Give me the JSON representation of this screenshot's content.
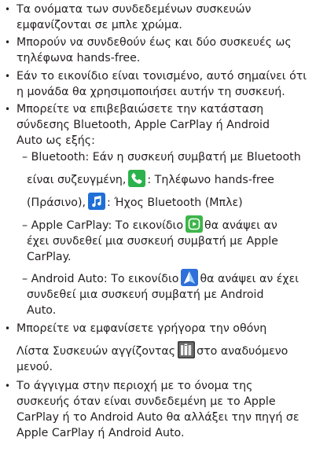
{
  "bullets": {
    "b1": [
      "Τα ονόματα των συνδεδεμένων συσκευών",
      "εμφανίζονται σε μπλε χρώμα."
    ],
    "b2": [
      "Μπορούν να συνδεθούν έως και δύο συσκευές ως",
      "τηλέφωνα hands-free."
    ],
    "b3": [
      "Εάν το εικονίδιο είναι τονισμένο, αυτό σημαίνει ότι",
      "η μονάδα θα χρησιμοποιήσει αυτήν τη συσκευή."
    ],
    "b4": [
      "Μπορείτε να επιβεβαιώσετε την κατάσταση",
      "σύνδεσης Bluetooth, Apple CarPlay ή Android",
      "Auto ως εξής:"
    ],
    "b5_l1": "Μπορείτε να εμφανίσετε γρήγορα την οθόνη",
    "b5_l2a": "Λίστα Συσκευών αγγίζοντας",
    "b5_l2b": "στο αναδυόμενο",
    "b5_l3": "μενού.",
    "b6": [
      "Το άγγιγμα στην περιοχή με το όνομα της",
      "συσκευής όταν είναι συνδεδεμένη με το Apple",
      "CarPlay ή το Android Auto θα αλλάξει την πηγή σε",
      "Apple CarPlay ή Android Auto."
    ]
  },
  "subs": {
    "bt_l1": "– Bluetooth: Εάν η συσκευή συμβατή με Bluetooth",
    "bt_l2a": "είναι συζευγμένη,",
    "bt_l2b": ": Τηλέφωνο hands-free",
    "bt_l3a": "(Πράσινο),",
    "bt_l3b": ": Ήχος Bluetooth (Μπλε)",
    "cp_l1a": "– Apple CarPlay: Το εικονίδιο",
    "cp_l1b": "θα ανάψει αν",
    "cp_l2": "έχει συνδεθεί μια συσκευή συμβατή με Apple",
    "cp_l3": "CarPlay.",
    "aa_l1a": "– Android Auto: Το εικονίδιο",
    "aa_l1b": "θα ανάψει αν έχει",
    "aa_l2": "συνδεθεί μια συσκευή συμβατή με Android",
    "aa_l3": "Auto."
  },
  "bullet_char": "•",
  "icons": {
    "phone": {
      "name": "phone-icon",
      "color": "#2bb24c"
    },
    "music": {
      "name": "music-note-icon",
      "color": "#1f6fd6"
    },
    "carplay": {
      "name": "carplay-icon",
      "color": "#3db54a"
    },
    "android_auto": {
      "name": "android-auto-icon",
      "color": "#2f6fd9"
    },
    "device_list": {
      "name": "device-list-icon",
      "color": "#333333"
    }
  }
}
